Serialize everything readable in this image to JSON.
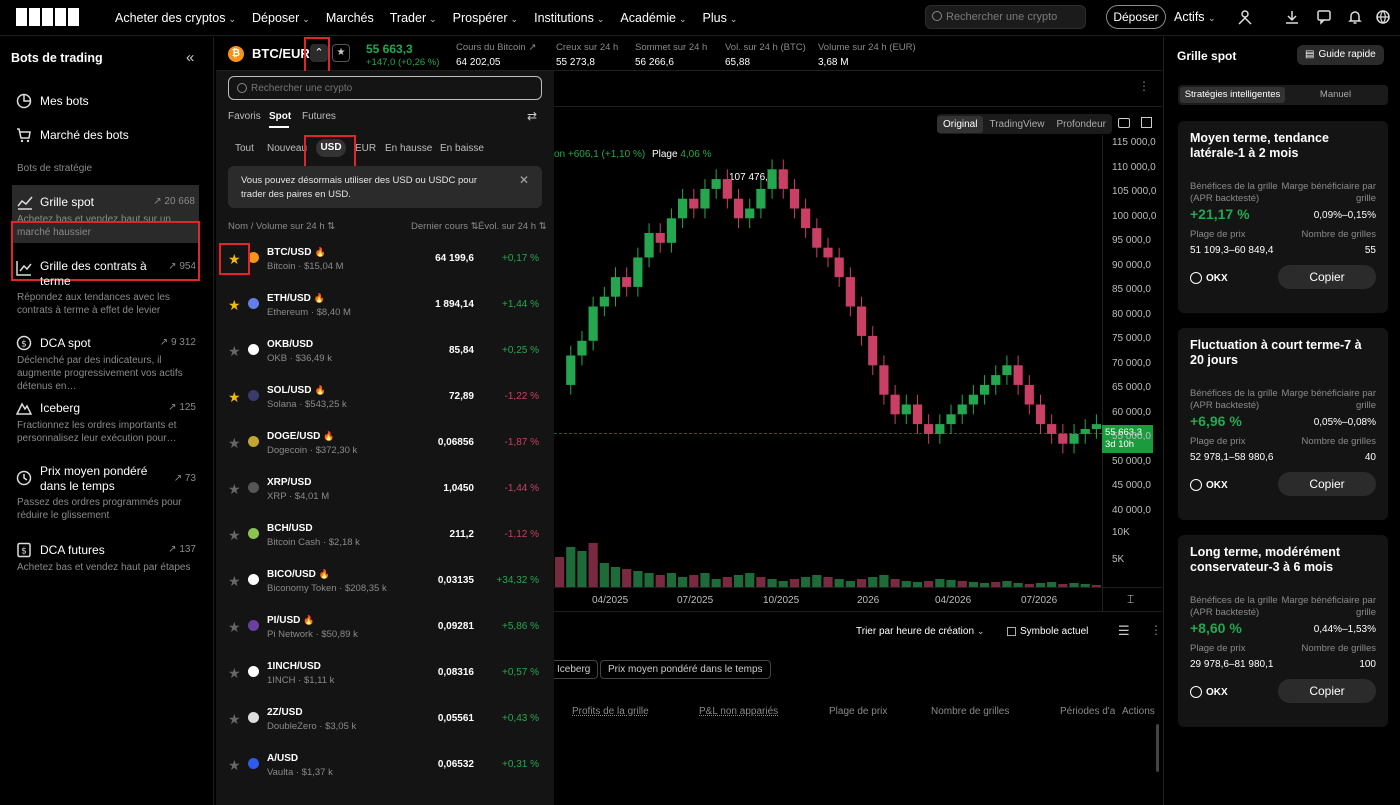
{
  "nav": {
    "items": [
      {
        "label": "Acheter des cryptos",
        "chev": true
      },
      {
        "label": "Déposer",
        "chev": true
      },
      {
        "label": "Marchés",
        "chev": false
      },
      {
        "label": "Trader",
        "chev": true
      },
      {
        "label": "Prospérer",
        "chev": true
      },
      {
        "label": "Institutions",
        "chev": true
      },
      {
        "label": "Académie",
        "chev": true
      },
      {
        "label": "Plus",
        "chev": true
      }
    ],
    "search_placeholder": "Rechercher une crypto",
    "deposit_label": "Déposer",
    "assets_label": "Actifs"
  },
  "sidebar": {
    "title": "Bots de trading",
    "top_items": [
      {
        "label": "Mes bots"
      },
      {
        "label": "Marché des bots"
      }
    ],
    "section_label": "Bots de stratégie",
    "strategies": [
      {
        "label": "Grille spot",
        "count": "20 668",
        "desc": "Achetez bas et vendez haut sur un marché haussier"
      },
      {
        "label": "Grille des contrats à terme",
        "count": "954",
        "desc": "Répondez aux tendances avec les contrats à terme à effet de levier"
      },
      {
        "label": "DCA spot",
        "count": "9 312",
        "desc": "Déclenché par des indicateurs, il augmente progressivement vos actifs détenus en…"
      },
      {
        "label": "Iceberg",
        "count": "125",
        "desc": "Fractionnez les ordres importants et personnalisez leur exécution pour…"
      },
      {
        "label": "Prix moyen pondéré dans le temps",
        "count": "73",
        "desc": "Passez des ordres programmés pour réduire le glissement"
      },
      {
        "label": "DCA futures",
        "count": "137",
        "desc": "Achetez bas et vendez haut par étapes"
      }
    ]
  },
  "pair": {
    "symbol": "BTC/EUR",
    "last": "55 663,3",
    "change": "+147,0 (+0,26 %)",
    "stats": [
      {
        "label": "Cours du Bitcoin",
        "value": "64 202,05"
      },
      {
        "label": "Creux sur 24 h",
        "value": "55 273,8"
      },
      {
        "label": "Sommet sur 24 h",
        "value": "56 266,6"
      },
      {
        "label": "Vol. sur 24 h (BTC)",
        "value": "65,88"
      },
      {
        "label": "Volume sur 24 h (EUR)",
        "value": "3,68 M"
      }
    ]
  },
  "dropdown": {
    "search_placeholder": "Rechercher une crypto",
    "tabs": [
      "Favoris",
      "Spot",
      "Futures"
    ],
    "active_tab": "Spot",
    "subtabs": [
      "Tout",
      "Nouveau",
      "USD",
      "EUR",
      "En hausse",
      "En baisse"
    ],
    "active_subtab": "USD",
    "notice": "Vous pouvez désormais utiliser des USD ou USDC pour trader des paires en USD.",
    "col_name": "Nom / Volume sur 24 h",
    "col_price": "Dernier cours",
    "col_change": "Évol. sur 24 h",
    "rows": [
      {
        "pair": "BTC/USD",
        "sub": "Bitcoin · $15,04 M",
        "price": "64 199,6",
        "change": "+0,17 %",
        "up": true,
        "fav": true,
        "hot": true,
        "color": "#f7931a"
      },
      {
        "pair": "ETH/USD",
        "sub": "Ethereum · $8,40 M",
        "price": "1 894,14",
        "change": "+1,44 %",
        "up": true,
        "fav": true,
        "hot": true,
        "color": "#627eea"
      },
      {
        "pair": "OKB/USD",
        "sub": "OKB · $36,49 k",
        "price": "85,84",
        "change": "+0,25 %",
        "up": true,
        "fav": false,
        "hot": false,
        "color": "#ffffff"
      },
      {
        "pair": "SOL/USD",
        "sub": "Solana · $543,25 k",
        "price": "72,89",
        "change": "-1,22 %",
        "up": false,
        "fav": true,
        "hot": true,
        "color": "#3b3b6b"
      },
      {
        "pair": "DOGE/USD",
        "sub": "Dogecoin · $372,30 k",
        "price": "0,06856",
        "change": "-1,87 %",
        "up": false,
        "fav": false,
        "hot": true,
        "color": "#c2a633"
      },
      {
        "pair": "XRP/USD",
        "sub": "XRP · $4,01 M",
        "price": "1,0450",
        "change": "-1,44 %",
        "up": false,
        "fav": false,
        "hot": false,
        "color": "#555555"
      },
      {
        "pair": "BCH/USD",
        "sub": "Bitcoin Cash · $2,18 k",
        "price": "211,2",
        "change": "-1,12 %",
        "up": false,
        "fav": false,
        "hot": false,
        "color": "#8dc351"
      },
      {
        "pair": "BICO/USD",
        "sub": "Biconomy Token · $208,35 k",
        "price": "0,03135",
        "change": "+34,32 %",
        "up": true,
        "fav": false,
        "hot": true,
        "color": "#ffffff"
      },
      {
        "pair": "PI/USD",
        "sub": "Pi Network · $50,89 k",
        "price": "0,09281",
        "change": "+5,86 %",
        "up": true,
        "fav": false,
        "hot": true,
        "color": "#6b3fa0"
      },
      {
        "pair": "1INCH/USD",
        "sub": "1INCH · $1,11 k",
        "price": "0,08316",
        "change": "+0,57 %",
        "up": true,
        "fav": false,
        "hot": false,
        "color": "#ffffff"
      },
      {
        "pair": "2Z/USD",
        "sub": "DoubleZero · $3,05 k",
        "price": "0,05561",
        "change": "+0,43 %",
        "up": true,
        "fav": false,
        "hot": false,
        "color": "#dddddd"
      },
      {
        "pair": "A/USD",
        "sub": "Vaulta · $1,37 k",
        "price": "0,06532",
        "change": "+0,31 %",
        "up": true,
        "fav": false,
        "hot": false,
        "color": "#2f5bea"
      }
    ]
  },
  "chart": {
    "view_tabs": [
      "Original",
      "TradingView",
      "Profondeur"
    ],
    "active_view": "Original",
    "info_change": "on +606,1 (+1,10 %)",
    "info_range_label": "Plage",
    "info_range_value": "4,06 %",
    "high_label": "107 476,6",
    "price_badge": "55 663,3",
    "badge_time": "3d 10h",
    "y_ticks": [
      "115 000,0",
      "110 000,0",
      "105 000,0",
      "100 000,0",
      "95 000,0",
      "90 000,0",
      "85 000,0",
      "80 000,0",
      "75 000,0",
      "70 000,0",
      "65 000,0",
      "60 000,0",
      "55 000,0",
      "50 000,0",
      "45 000,0",
      "40 000,0"
    ],
    "vol_ticks": [
      "10K",
      "5K"
    ],
    "x_ticks": [
      "04/2025",
      "07/2025",
      "10/2025",
      "2026",
      "04/2026",
      "07/2026"
    ]
  },
  "bottom": {
    "sort_label": "Trier par heure de création",
    "checkbox_label": "Symbole actuel",
    "filters": [
      "Iceberg",
      "Prix moyen pondéré dans le temps"
    ],
    "cols": [
      "Profits de la grille",
      "P&L non appariés",
      "Plage de prix",
      "Nombre de grilles",
      "Périodes d'ar",
      "Actions"
    ]
  },
  "right": {
    "title": "Grille spot",
    "guide_label": "Guide rapide",
    "tabs": [
      "Stratégies intelligentes",
      "Manuel"
    ],
    "active_tab": "Stratégies intelligentes",
    "cards": [
      {
        "title": "Moyen terme, tendance latérale-1 à 2 mois",
        "l1": "Bénéfices de la grille (APR backtesté)",
        "r1": "Marge bénéficiaire par grille",
        "apr": "+21,17 %",
        "margin": "0,09%–0,15%",
        "l3": "Plage de prix",
        "r3": "Nombre de grilles",
        "range": "51 109,3–60 849,4",
        "grids": "55",
        "brand": "OKX",
        "copy": "Copier"
      },
      {
        "title": "Fluctuation à court terme-7 à 20 jours",
        "l1": "Bénéfices de la grille (APR backtesté)",
        "r1": "Marge bénéficiaire par grille",
        "apr": "+6,96 %",
        "margin": "0,05%–0,08%",
        "l3": "Plage de prix",
        "r3": "Nombre de grilles",
        "range": "52 978,1–58 980,6",
        "grids": "40",
        "brand": "OKX",
        "copy": "Copier"
      },
      {
        "title": "Long terme, modérément conservateur-3 à 6 mois",
        "l1": "Bénéfices de la grille (APR backtesté)",
        "r1": "Marge bénéficiaire par grille",
        "apr": "+8,60 %",
        "margin": "0,44%–1,53%",
        "l3": "Plage de prix",
        "r3": "Nombre de grilles",
        "range": "29 978,6–81 980,1",
        "grids": "100",
        "brand": "OKX",
        "copy": "Copier"
      }
    ]
  }
}
